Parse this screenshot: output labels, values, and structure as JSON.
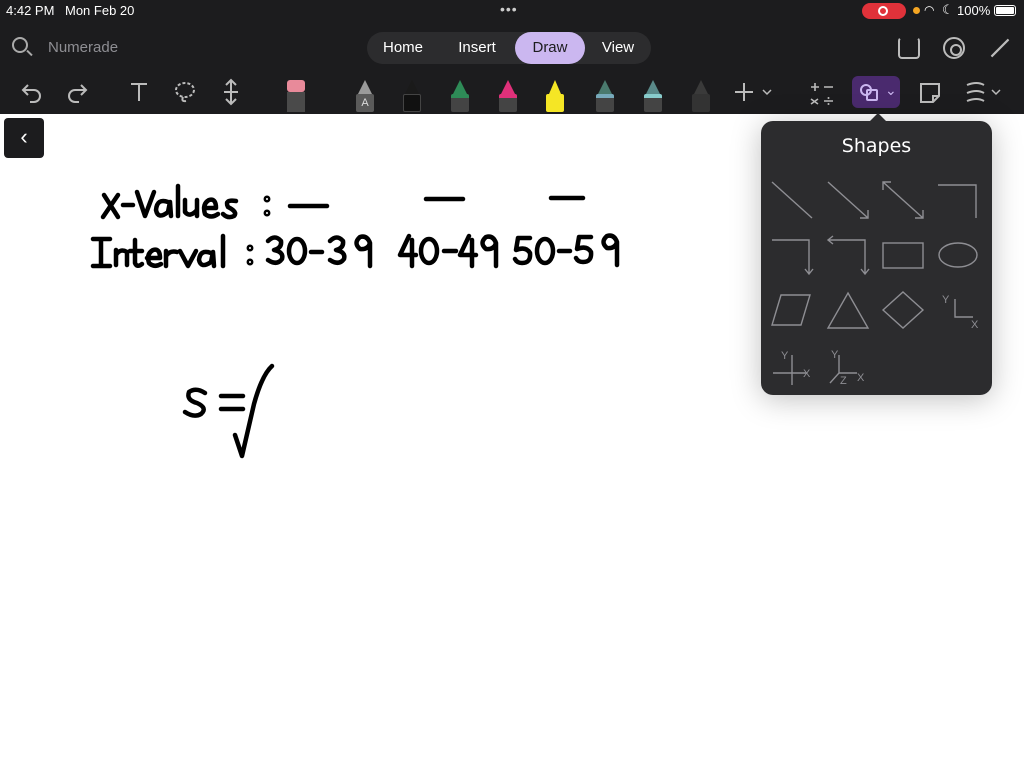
{
  "status": {
    "time": "4:42 PM",
    "date": "Mon Feb 20",
    "battery": "100%"
  },
  "search": {
    "label": "Numerade"
  },
  "tabs": [
    {
      "label": "Home",
      "active": false
    },
    {
      "label": "Insert",
      "active": false
    },
    {
      "label": "Draw",
      "active": true
    },
    {
      "label": "View",
      "active": false
    }
  ],
  "toolbar": {
    "tools": [
      "undo-icon",
      "redo-icon",
      "text-icon",
      "lasso-icon",
      "insert-space-icon",
      "eraser-icon"
    ],
    "pens": [
      {
        "name": "pen-gray",
        "color": "#9a9a9a",
        "label": "A"
      },
      {
        "name": "pen-black",
        "color": "#1a1a1a"
      },
      {
        "name": "pen-green",
        "color": "#2e8b57"
      },
      {
        "name": "pen-pink",
        "color": "#e0307a"
      },
      {
        "name": "highlighter-yellow",
        "color": "#f5e625"
      },
      {
        "name": "pen-galaxy",
        "color": "#4a7a6e"
      },
      {
        "name": "pen-teal",
        "color": "#5a8a8a"
      },
      {
        "name": "pen-dark",
        "color": "#3a3a3a"
      }
    ]
  },
  "shapes_popover": {
    "title": "Shapes",
    "axis_labels": {
      "y": "Y",
      "x": "X",
      "z": "Z"
    }
  },
  "canvas": {
    "row1_label": "x-values:",
    "row2_label": "Interval:",
    "intervals": [
      "30-39",
      "40-49",
      "50-59"
    ],
    "formula": "s ="
  }
}
